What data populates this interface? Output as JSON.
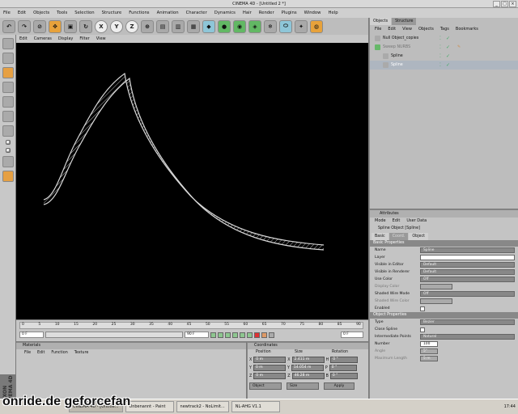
{
  "window": {
    "title": "CINEMA 4D - [Untitled 2 *]"
  },
  "menu": [
    "File",
    "Edit",
    "Objects",
    "Tools",
    "Selection",
    "Structure",
    "Functions",
    "Animation",
    "Character",
    "Dynamics",
    "Hair",
    "Render",
    "Plugins",
    "Window",
    "Help"
  ],
  "toolbar": {
    "axis_x": "X",
    "axis_y": "Y",
    "axis_z": "Z"
  },
  "viewport": {
    "menu": [
      "Edit",
      "Cameras",
      "Display",
      "Filter",
      "View"
    ]
  },
  "timeline": {
    "ticks": [
      "0",
      "5",
      "10",
      "15",
      "20",
      "25",
      "30",
      "35",
      "40",
      "45",
      "50",
      "55",
      "60",
      "65",
      "70",
      "75",
      "80",
      "85",
      "90"
    ],
    "start_frame": "0 F",
    "end_frame": "90 F",
    "current_frame": "0 F"
  },
  "materials": {
    "title": "Materials",
    "menu": [
      "File",
      "Edit",
      "Function",
      "Texture"
    ]
  },
  "coordinates": {
    "title": "Coordinates",
    "headers": [
      "Position",
      "Size",
      "Rotation"
    ],
    "rows": [
      {
        "axis": "X",
        "pos": "0 m",
        "size_axis": "X",
        "size": "2.411 m",
        "rot_axis": "H",
        "rot": "0 °"
      },
      {
        "axis": "Y",
        "pos": "0 m",
        "size_axis": "Y",
        "size": "14.054 m",
        "rot_axis": "P",
        "rot": "0 °"
      },
      {
        "axis": "Z",
        "pos": "0 m",
        "size_axis": "Z",
        "size": "46.28 m",
        "rot_axis": "B",
        "rot": "0 °"
      }
    ],
    "mode": "Object",
    "size_mode": "Size",
    "apply": "Apply"
  },
  "objects": {
    "tabs": [
      "Objects",
      "Structure"
    ],
    "menu": [
      "File",
      "Edit",
      "View",
      "Objects",
      "Tags",
      "Bookmarks"
    ],
    "items": [
      {
        "name": "Null Object_copies",
        "indent": 0
      },
      {
        "name": "Sweep NURBS",
        "indent": 0
      },
      {
        "name": "Spline",
        "indent": 1
      },
      {
        "name": "Spline",
        "indent": 1
      }
    ]
  },
  "attributes": {
    "title": "Attributes",
    "menu": [
      "Mode",
      "Edit",
      "User Data"
    ],
    "object_title": "Spline Object [Spline]",
    "tabs": [
      "Basic",
      "Coord.",
      "Object"
    ],
    "basic_section": "Basic Properties",
    "basic": [
      {
        "label": "Name",
        "value": "Spline"
      },
      {
        "label": "Layer",
        "value": ""
      },
      {
        "label": "Visible in Editor",
        "value": "Default"
      },
      {
        "label": "Visible in Renderer",
        "value": "Default"
      },
      {
        "label": "Use Color",
        "value": "Off"
      },
      {
        "label": "Display Color",
        "value": ""
      },
      {
        "label": "Shaded Wire Mode",
        "value": "Off"
      },
      {
        "label": "Shaded Wire Color",
        "value": ""
      },
      {
        "label": "Enabled",
        "value": ""
      }
    ],
    "object_section": "Object Properties",
    "object": [
      {
        "label": "Type",
        "value": "Bezier"
      },
      {
        "label": "Close Spline",
        "value": ""
      },
      {
        "label": "Intermediate Points",
        "value": "Natural"
      },
      {
        "label": "Number",
        "value": "100"
      },
      {
        "label": "Angle",
        "value": "5°"
      },
      {
        "label": "Maximum Length",
        "value": "5 m"
      }
    ]
  },
  "branding": {
    "maxon": "MAXON CINEMA 4D"
  },
  "taskbar": {
    "items": [
      "CINEMA 4D - [Untitle...",
      "Unbenannt - Paint",
      "newtrack2 - NoLimit...",
      "NL-AHG V1.1"
    ],
    "clock": "17:44"
  },
  "watermark": "onride.de   geforcefan"
}
